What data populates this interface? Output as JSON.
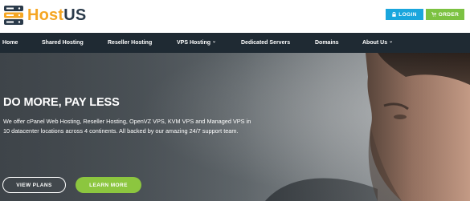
{
  "brand": {
    "name_part1": "Host",
    "name_part2": "US",
    "accent": "#f5a623",
    "dark": "#2a3a4a"
  },
  "top_buttons": {
    "login": "LOGIN",
    "order": "ORDER",
    "login_icon": "lock-icon",
    "order_icon": "cart-icon",
    "login_color": "#1aa6dd",
    "order_color": "#7cc242"
  },
  "nav": {
    "home": "Home",
    "shared_hosting": "Shared Hosting",
    "reseller_hosting": "Reseller Hosting",
    "vps_hosting": "VPS Hosting",
    "dedicated_servers": "Dedicated Servers",
    "domains": "Domains",
    "about_us": "About Us",
    "background": "#1f2a33"
  },
  "hero": {
    "title": "DO MORE, PAY LESS",
    "description": "We offer cPanel Web Hosting, Reseller Hosting, OpenVZ VPS, KVM VPS and Managed VPS in 10 datacenter locations across 4 continents. All backed by our amazing 24/7 support team.",
    "view_plans": "VIEW PLANS",
    "learn_more": "LEARN MORE",
    "learn_more_color": "#8cc63f"
  }
}
